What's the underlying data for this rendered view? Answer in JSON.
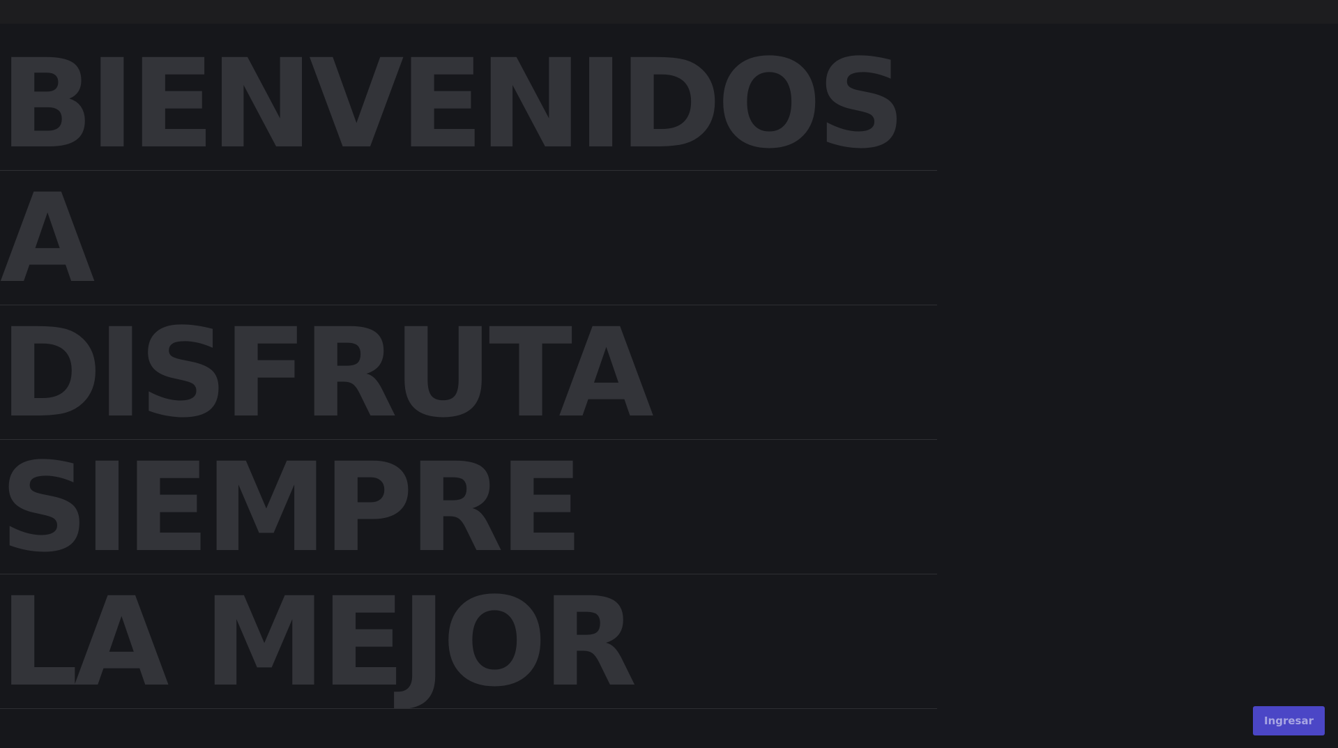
{
  "hero": {
    "lines": [
      "BIENVENIDOS",
      "A",
      "DISFRUTA",
      "SIEMPRE",
      "LA MEJOR"
    ]
  },
  "cta": {
    "label": "Ingresar",
    "color": "#4b46c6"
  },
  "colors": {
    "background": "#16171b",
    "topbar": "#1d1d1f",
    "hero_text": "#333439",
    "divider": "#2e2f33"
  }
}
